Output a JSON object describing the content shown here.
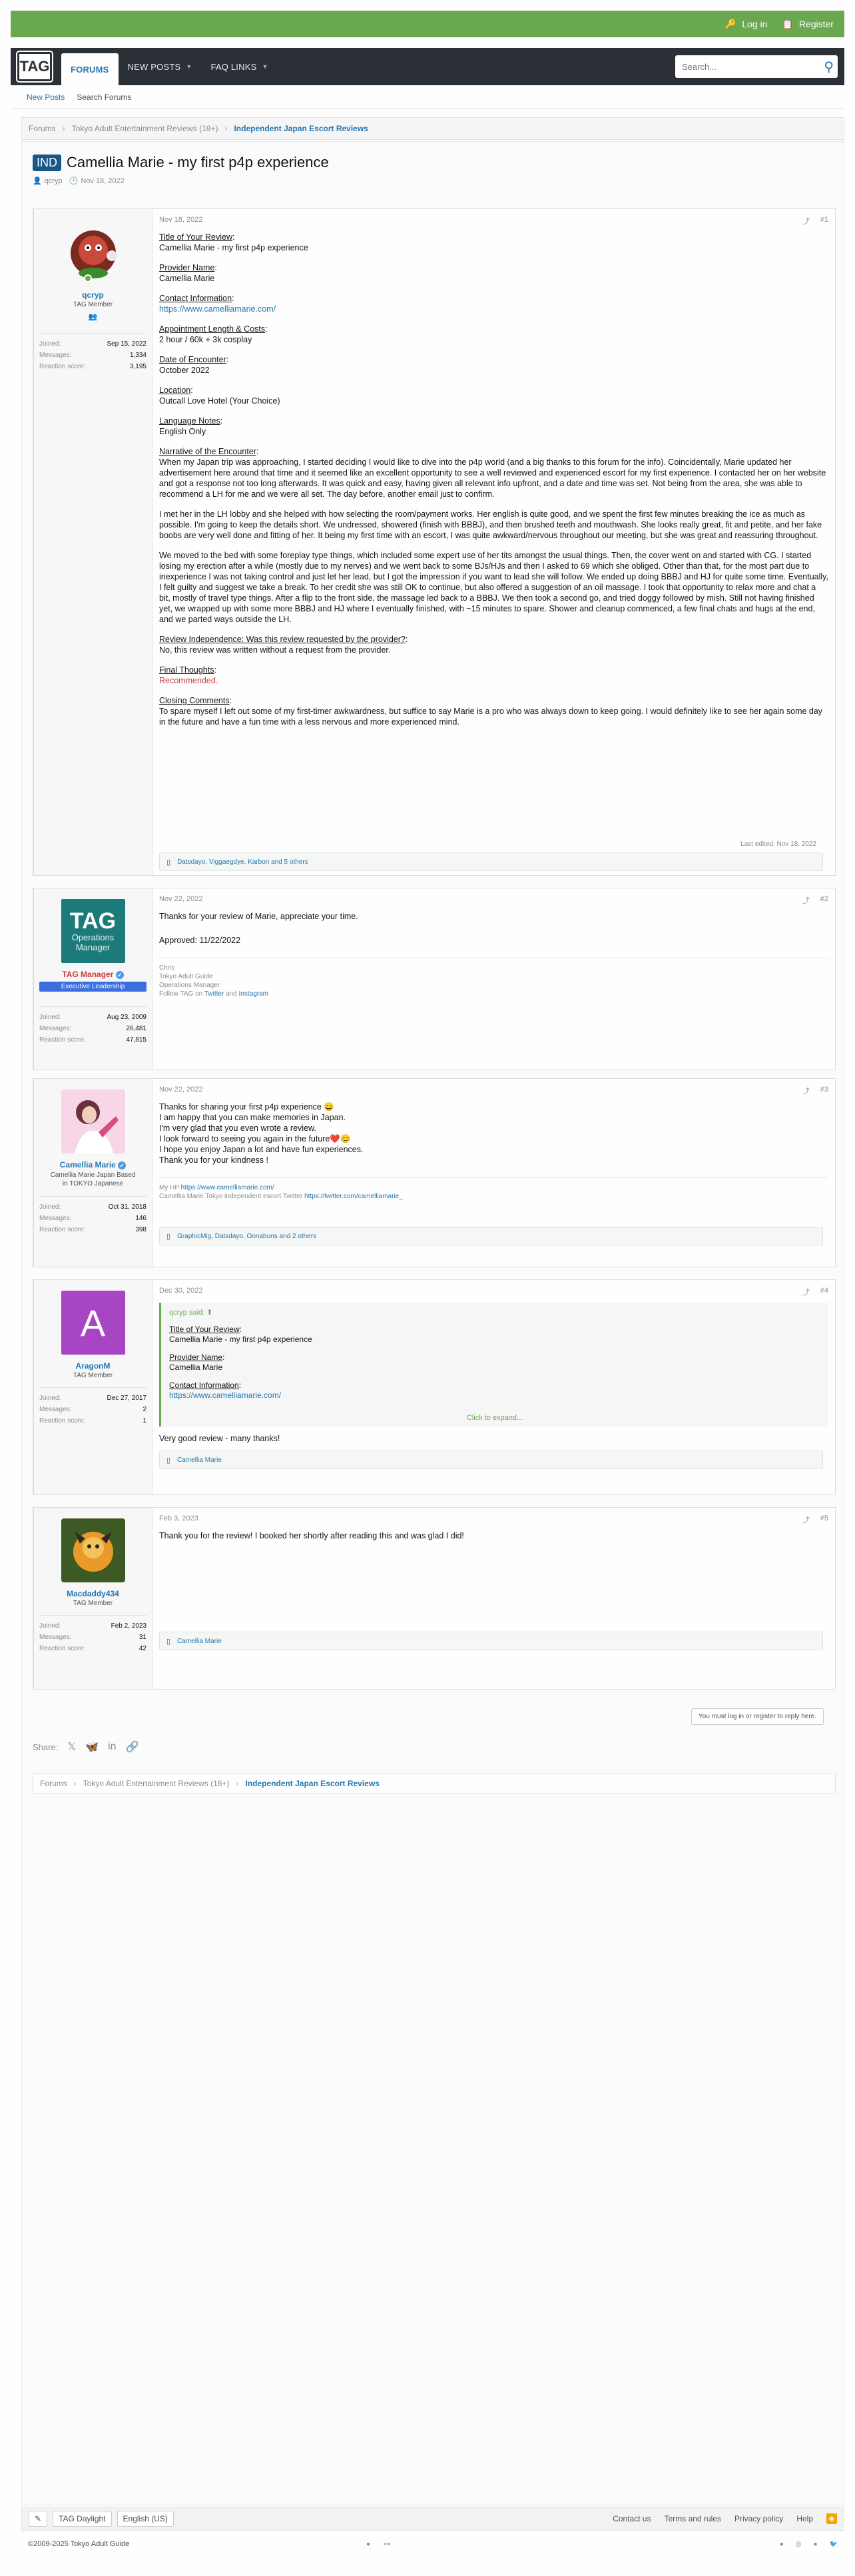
{
  "top": {
    "login": "Log in",
    "register": "Register"
  },
  "nav": {
    "logo": "TAG",
    "tabs": [
      {
        "label": "FORUMS"
      },
      {
        "label": "NEW POSTS"
      },
      {
        "label": "FAQ LINKS"
      }
    ],
    "search_placeholder": "Search..."
  },
  "subnav": {
    "new_posts": "New Posts",
    "search_forums": "Search Forums"
  },
  "breadcrumb": [
    "Forums",
    "Tokyo Adult Entertainment Reviews (18+)",
    "Independent Japan Escort Reviews"
  ],
  "thread": {
    "prefix": "IND",
    "title": "Camellia Marie - my first p4p experience",
    "author": "qcryp",
    "date": "Nov 18, 2022"
  },
  "stat_labels": {
    "joined": "Joined:",
    "messages": "Messages:",
    "reaction": "Reaction score:"
  },
  "posts": [
    {
      "date": "Nov 18, 2022",
      "num": "#1",
      "user": {
        "name": "qcryp",
        "title": "TAG Member",
        "joined": "Sep 15, 2022",
        "messages": "1,334",
        "reaction": "3,195"
      },
      "sections": [
        {
          "label": "Title of Your Review",
          "value": "Camellia Marie - my first p4p experience"
        },
        {
          "label": "Provider Name",
          "value": "Camellia Marie"
        },
        {
          "label": "Contact Information",
          "value": "https://www.camelliamarie.com/"
        },
        {
          "label": "Appointment Length & Costs",
          "value": "2 hour / 60k + 3k cosplay"
        },
        {
          "label": "Date of Encounter",
          "value": "October 2022"
        },
        {
          "label": "Location",
          "value": "Outcall Love Hotel (Your Choice)"
        },
        {
          "label": "Language Notes",
          "value": "English Only"
        },
        {
          "label": "Narrative of the Encounter",
          "value": "When my Japan trip was approaching, I started deciding I would like to dive into the p4p world (and a big thanks to this forum for the info). Coincidentally, Marie updated her advertisement here around that time and it seemed like an excellent opportunity to see a well reviewed and experienced escort for my first experience. I contacted her on her website and got a response not too long afterwards. It was quick and easy, having given all relevant info upfront, and a date and time was set. Not being from the area, she was able to recommend a LH for me and we were all set. The day before, another email just to confirm."
        }
      ],
      "narr2": "I met her in the LH lobby and she helped with how selecting the room/payment works. Her english is quite good, and we spent the first few minutes breaking the ice as much as possible. I'm going to keep the details short. We undressed, showered (finish with BBBJ), and then brushed teeth and mouthwash. She looks really great, fit and petite, and her fake boobs are very well done and fitting of her. It being my first time with an escort, I was quite awkward/nervous throughout our meeting, but she was great and reassuring throughout.",
      "narr3": "We moved to the bed with some foreplay type things, which included some expert use of her tits amongst the usual things. Then, the cover went on and started with CG. I started losing my erection after a while (mostly due to my nerves) and we went back to some BJs/HJs and then I asked to 69 which she obliged. Other than that, for the most part due to inexperience I was not taking control and just let her lead, but I got the impression if you want to lead she will follow. We ended up doing BBBJ and HJ for quite some time. Eventually, I felt guilty and suggest we take a break. To her credit she was still OK to continue, but also offered a suggestion of an oil massage. I took that opportunity to relax more and chat a bit, mostly of travel type things. After a flip to the front side, the massage led back to a BBBJ. We then took a second go, and tried doggy followed by mish. Still not having finished yet, we wrapped up with some more BBBJ and HJ where I eventually finished, with ~15 minutes to spare. Shower and cleanup commenced, a few final chats and hugs at the end, and we parted ways outside the LH.",
      "indep_label": "Review Independence: Was this review requested by the provider?",
      "indep_value": "No, this review was written without a request from the provider.",
      "final_label": "Final Thoughts",
      "final_value": "Recommended.",
      "closing_label": "Closing Comments",
      "closing_value": "To spare myself I left out some of my first-timer awkwardness, but suffice to say Marie is a pro who was always down to keep going. I would definitely like to see her again some day in the future and have a fun time with a less nervous and more experienced mind.",
      "edited": "Last edited: Nov 18, 2022",
      "reactions": "Datsdayo, Viggaegdye, Karbon and 5 others"
    },
    {
      "date": "Nov 22, 2022",
      "num": "#2",
      "user": {
        "name": "TAG Manager",
        "title": "TAG Operations Manager",
        "banner": "Executive Leadership",
        "joined": "Aug 23, 2009",
        "messages": "26,481",
        "reaction": "47,815"
      },
      "line1": "Thanks for your review of Marie, appreciate your time.",
      "line2": "Approved: 11/22/2022",
      "sig1": "Chris",
      "sig2": "Tokyo Adult Guide",
      "sig3": "Operations Manager",
      "sig4_pre": "Follow TAG on",
      "sig4_tw": "Twitter",
      "sig4_and": "and",
      "sig4_ig": "Instagram"
    },
    {
      "date": "Nov 22, 2022",
      "num": "#3",
      "user": {
        "name": "Camellia Marie",
        "title": "Camellia Marie Japan Based in TOKYO Japanese",
        "joined": "Oct 31, 2018",
        "messages": "146",
        "reaction": "398"
      },
      "lines": [
        "Thanks for sharing your first p4p experience 😄",
        "I am happy that you can make memories in Japan.",
        "I'm very glad that you even wrote a review.",
        "I look forward to seeing you again in the future❤️😊",
        "I hope you enjoy Japan a lot and have fun experiences.",
        "Thank you for your kindness !"
      ],
      "sig1_pre": "My HP",
      "sig1_link": "https://www.camelliamarie.com/",
      "sig2_pre": "Camellia Marie Tokyo independent escort Twitter",
      "sig2_link": "https://twitter.com/camelliamarie_",
      "reactions": "GraphicMig, Datsdayo, Oonabuns and 2 others"
    },
    {
      "date": "Dec 30, 2022",
      "num": "#4",
      "user": {
        "name": "AragonM",
        "initial": "A",
        "title": "TAG Member",
        "joined": "Dec 27, 2017",
        "messages": "2",
        "reaction": "1"
      },
      "quote_head": "qcryp said:",
      "q1l": "Title of Your Review",
      "q1v": "Camellia Marie - my first p4p experience",
      "q2l": "Provider Name",
      "q2v": "Camellia Marie",
      "q3l": "Contact Information",
      "q3v": "https://www.camelliamarie.com/",
      "expand": "Click to expand...",
      "text": "Very good review - many thanks!",
      "reactions": "Camellia Marie"
    },
    {
      "date": "Feb 3, 2023",
      "num": "#5",
      "user": {
        "name": "Macdaddy434",
        "title": "TAG Member",
        "joined": "Feb 2, 2023",
        "messages": "31",
        "reaction": "42"
      },
      "text": "Thank you for the review! I booked her shortly after reading this and was glad I did!",
      "reactions": "Camellia Marie"
    }
  ],
  "reply_note": "You must log in or register to reply here.",
  "share": {
    "label": "Share:"
  },
  "footer": {
    "style": "TAG Daylight",
    "lang": "English (US)",
    "links": [
      "Contact us",
      "Terms and rules",
      "Privacy policy",
      "Help"
    ],
    "copyright": "©2009-2025 Tokyo Adult Guide"
  },
  "colors": {
    "accent": "#2577b1",
    "topbar": "#6aa84f",
    "nav": "#2b3036",
    "recommended": "#c83b3b"
  }
}
